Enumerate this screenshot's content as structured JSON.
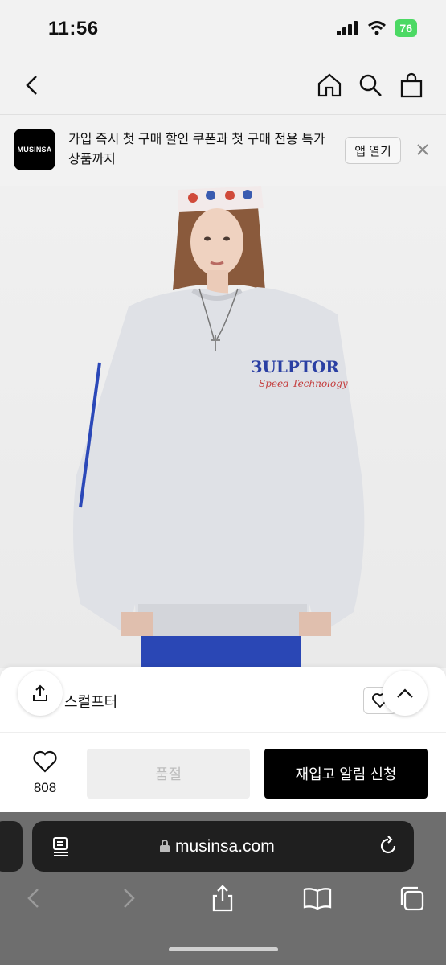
{
  "status": {
    "time": "11:56",
    "battery": "76"
  },
  "banner": {
    "logo_text": "MUSINSA",
    "text": "가입 즉시 첫 구매 할인 쿠폰과 첫 구매 전용 특가 상품까지",
    "open_app_label": "앱 열기"
  },
  "product": {
    "brand": "스컬프터",
    "likes": "808",
    "soldout_label": "품절",
    "restock_label": "재입고 알림 신청"
  },
  "browser": {
    "url": "musinsa.com"
  },
  "colors": {
    "black": "#000000",
    "soldout_bg": "#eeeeee",
    "soldout_text": "#bdbdbd",
    "browser_bg": "#6e6e6e"
  }
}
